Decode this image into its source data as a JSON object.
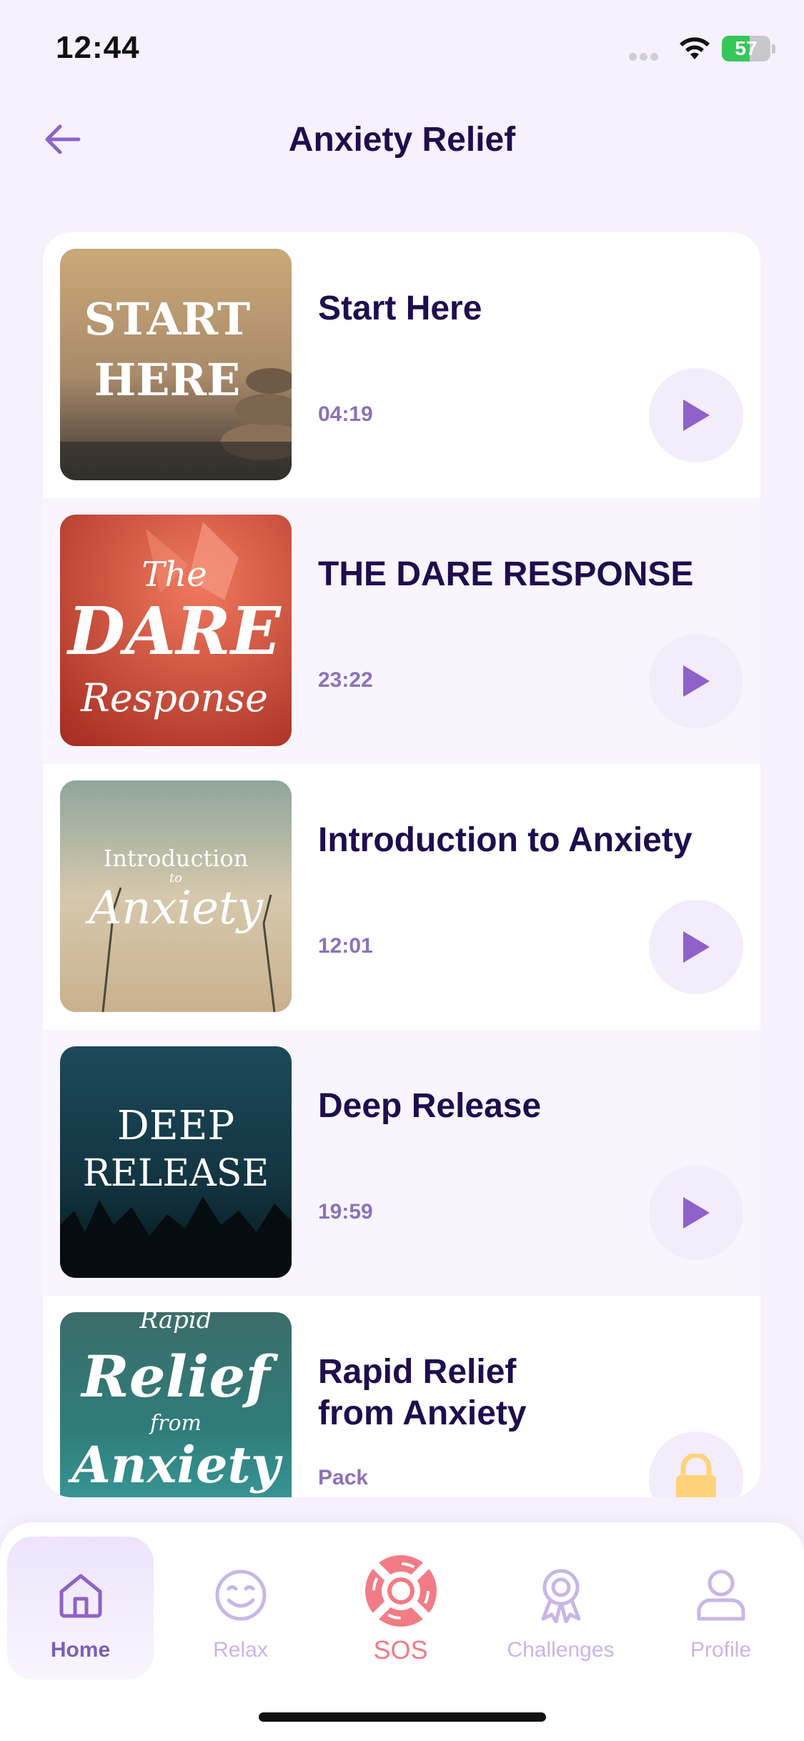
{
  "status_bar": {
    "time": "12:44",
    "battery": "57",
    "battery_level": 0.57
  },
  "header": {
    "title": "Anxiety Relief",
    "back_icon": "arrow-left-icon"
  },
  "items": [
    {
      "title": "Start Here",
      "duration": "04:19",
      "thumb_text": [
        "START",
        "HERE"
      ],
      "action_icon": "play-icon"
    },
    {
      "title": "THE DARE RESPONSE",
      "duration": "23:22",
      "thumb_text": [
        "The",
        "DARE",
        "Response"
      ],
      "action_icon": "play-icon"
    },
    {
      "title": "Introduction to Anxiety",
      "duration": "12:01",
      "thumb_text": [
        "Introduction",
        "to",
        "Anxiety"
      ],
      "action_icon": "play-icon"
    },
    {
      "title": "Deep Release",
      "duration": "19:59",
      "thumb_text": [
        "DEEP",
        "RELEASE"
      ],
      "action_icon": "play-icon"
    },
    {
      "title_line1": "Rapid Relief",
      "title_line2": "from Anxiety",
      "duration": "Pack",
      "thumb_text": [
        "Rapid",
        "Relief",
        "from",
        "Anxiety"
      ],
      "action_icon": "lock-icon"
    }
  ],
  "tabs": [
    {
      "label": "Home",
      "icon": "home-icon",
      "active": true
    },
    {
      "label": "Relax",
      "icon": "smile-icon",
      "active": false
    },
    {
      "label": "SOS",
      "icon": "lifebuoy-icon",
      "active": false
    },
    {
      "label": "Challenges",
      "icon": "award-icon",
      "active": false
    },
    {
      "label": "Profile",
      "icon": "user-icon",
      "active": false
    }
  ],
  "colors": {
    "background": "#f6f1fc",
    "title": "#1f0d4d",
    "accent": "#8b72b8",
    "play": "#8e62c9",
    "sos": "#f37b86",
    "lock": "#ffd37a"
  }
}
